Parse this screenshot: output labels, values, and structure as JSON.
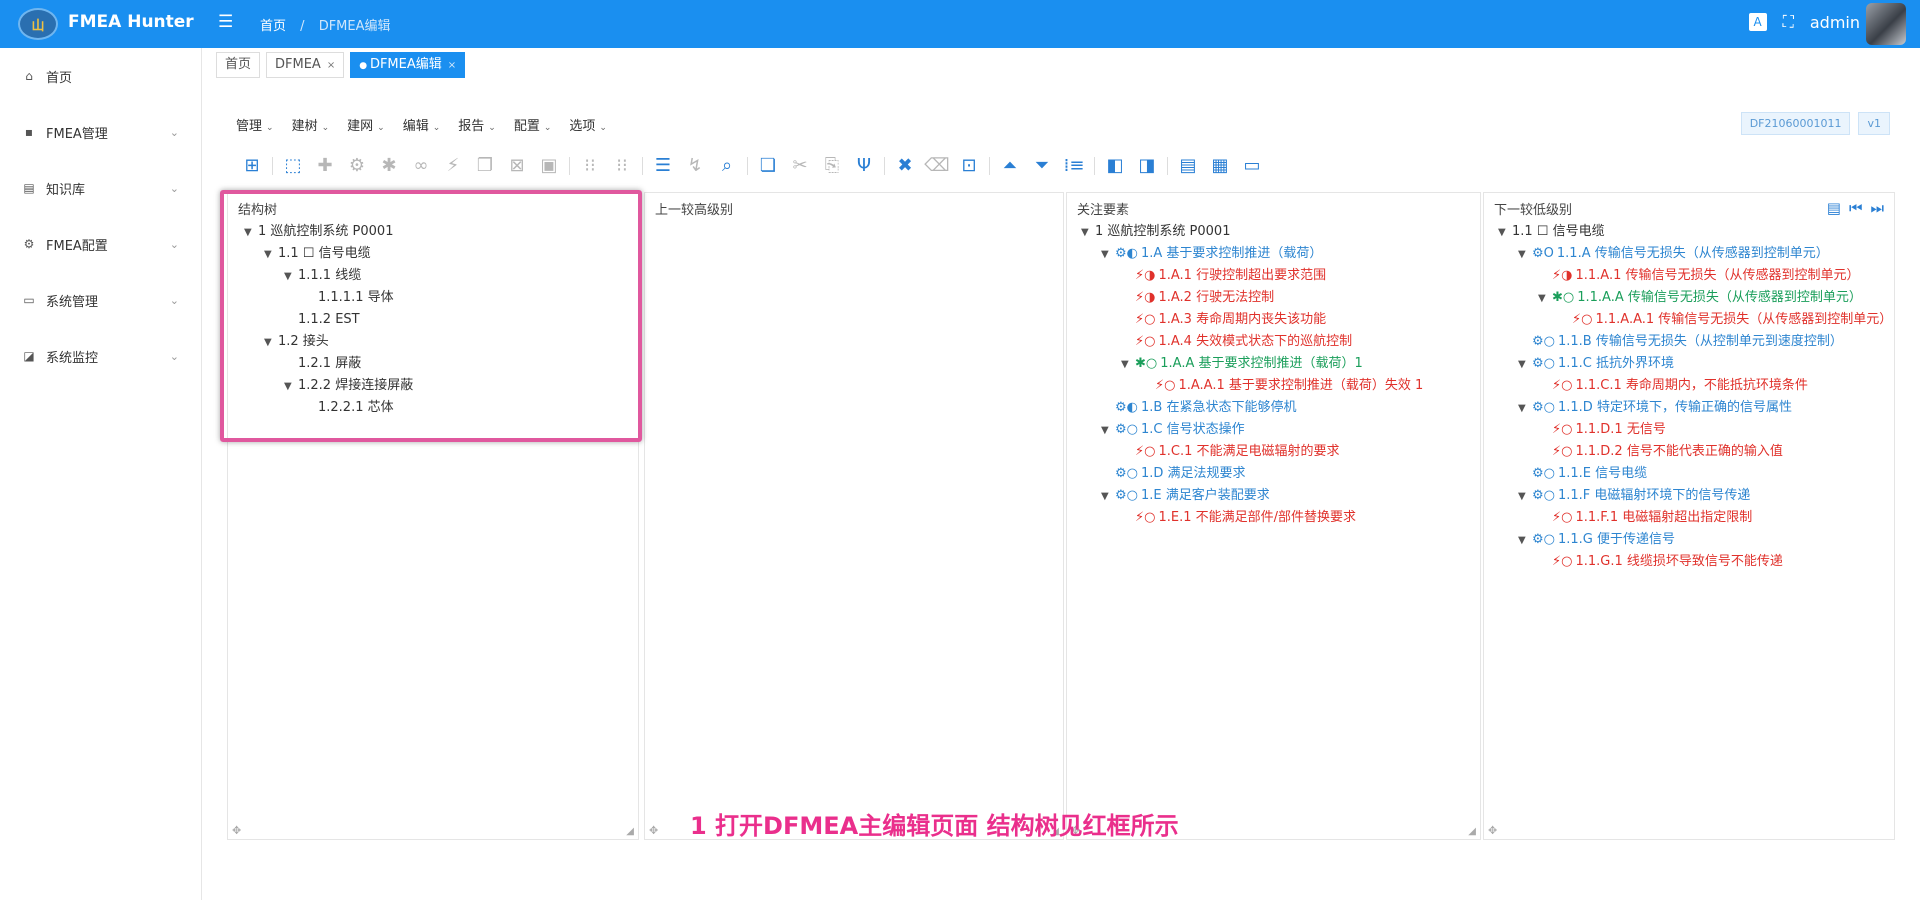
{
  "app": {
    "title": "FMEA Hunter",
    "logo_text": "山"
  },
  "header": {
    "breadcrumb": [
      "首页",
      "DFMEA编辑"
    ],
    "lang_label": "A",
    "user": "admin"
  },
  "sidebar": {
    "items": [
      {
        "label": "首页",
        "icon": "home-icon"
      },
      {
        "label": "FMEA管理",
        "icon": "fmea-icon"
      },
      {
        "label": "知识库",
        "icon": "book-icon"
      },
      {
        "label": "FMEA配置",
        "icon": "config-icon"
      },
      {
        "label": "系统管理",
        "icon": "monitor-icon"
      },
      {
        "label": "系统监控",
        "icon": "chart-icon"
      }
    ]
  },
  "tabs": [
    {
      "label": "首页",
      "closable": false,
      "active": false
    },
    {
      "label": "DFMEA",
      "closable": true,
      "active": false
    },
    {
      "label": "DFMEA编辑",
      "closable": true,
      "active": true
    }
  ],
  "menubar": [
    "管理",
    "建树",
    "建网",
    "编辑",
    "报告",
    "配置",
    "选项"
  ],
  "doc": {
    "id": "DF21060001011",
    "version": "v1"
  },
  "panels": {
    "structure": {
      "title": "结构树",
      "nodes": [
        {
          "text": "1 巡航控制系统 P0001",
          "level": 0,
          "toggle": "▼",
          "cls": "dark",
          "ico": ""
        },
        {
          "text": "1.1 ☐ 信号电缆",
          "level": 1,
          "toggle": "▼",
          "cls": "dark",
          "ico": ""
        },
        {
          "text": "1.1.1 线缆",
          "level": 2,
          "toggle": "▼",
          "cls": "dark",
          "ico": ""
        },
        {
          "text": "1.1.1.1 导体",
          "level": 3,
          "toggle": "",
          "cls": "dark",
          "ico": ""
        },
        {
          "text": "1.1.2 EST",
          "level": 2,
          "toggle": "",
          "cls": "dark",
          "ico": ""
        },
        {
          "text": "1.2 接头",
          "level": 1,
          "toggle": "▼",
          "cls": "dark",
          "ico": ""
        },
        {
          "text": "1.2.1 屏蔽",
          "level": 2,
          "toggle": "",
          "cls": "dark",
          "ico": ""
        },
        {
          "text": "1.2.2 焊接连接屏蔽",
          "level": 2,
          "toggle": "▼",
          "cls": "dark",
          "ico": ""
        },
        {
          "text": "1.2.2.1 芯体",
          "level": 3,
          "toggle": "",
          "cls": "dark",
          "ico": ""
        }
      ]
    },
    "upper": {
      "title": "上一较高级别"
    },
    "focus": {
      "title": "关注要素",
      "nodes": [
        {
          "text": "1 巡航控制系统 P0001",
          "level": 0,
          "toggle": "▼",
          "cls": "dark",
          "ico": ""
        },
        {
          "text": "1.A 基于要求控制推进（载荷）",
          "level": 1,
          "toggle": "▼",
          "cls": "blue",
          "ico": "⚙◐"
        },
        {
          "text": "1.A.1 行驶控制超出要求范围",
          "level": 2,
          "toggle": "",
          "cls": "red",
          "ico": "⚡◑"
        },
        {
          "text": "1.A.2 行驶无法控制",
          "level": 2,
          "toggle": "",
          "cls": "red",
          "ico": "⚡◑"
        },
        {
          "text": "1.A.3 寿命周期内丧失该功能",
          "level": 2,
          "toggle": "",
          "cls": "red",
          "ico": "⚡○"
        },
        {
          "text": "1.A.4 失效模式状态下的巡航控制",
          "level": 2,
          "toggle": "",
          "cls": "red",
          "ico": "⚡○"
        },
        {
          "text": "1.A.A 基于要求控制推进（载荷）1",
          "level": 2,
          "toggle": "▼",
          "cls": "green",
          "ico": "✱○"
        },
        {
          "text": "1.A.A.1 基于要求控制推进（载荷）失效 1",
          "level": 3,
          "toggle": "",
          "cls": "red",
          "ico": "⚡○"
        },
        {
          "text": "1.B 在紧急状态下能够停机",
          "level": 1,
          "toggle": "",
          "cls": "blue",
          "ico": "⚙◐"
        },
        {
          "text": "1.C 信号状态操作",
          "level": 1,
          "toggle": "▼",
          "cls": "blue",
          "ico": "⚙○"
        },
        {
          "text": "1.C.1 不能满足电磁辐射的要求",
          "level": 2,
          "toggle": "",
          "cls": "red",
          "ico": "⚡○"
        },
        {
          "text": "1.D 满足法规要求",
          "level": 1,
          "toggle": "",
          "cls": "blue",
          "ico": "⚙○"
        },
        {
          "text": "1.E 满足客户装配要求",
          "level": 1,
          "toggle": "▼",
          "cls": "blue",
          "ico": "⚙○"
        },
        {
          "text": "1.E.1 不能满足部件/部件替换要求",
          "level": 2,
          "toggle": "",
          "cls": "red",
          "ico": "⚡○"
        }
      ]
    },
    "lower": {
      "title": "下一较低级别",
      "nodes": [
        {
          "text": "1.1 ☐ 信号电缆",
          "level": 0,
          "toggle": "▼",
          "cls": "dark",
          "ico": ""
        },
        {
          "text": "1.1.A 传输信号无损失（从传感器到控制单元）",
          "level": 1,
          "toggle": "▼",
          "cls": "blue",
          "ico": "⚙O"
        },
        {
          "text": "1.1.A.1 传输信号无损失（从传感器到控制单元）",
          "level": 2,
          "toggle": "",
          "cls": "red",
          "ico": "⚡◑"
        },
        {
          "text": "1.1.A.A 传输信号无损失（从传感器到控制单元）",
          "level": 2,
          "toggle": "▼",
          "cls": "green",
          "ico": "✱○"
        },
        {
          "text": "1.1.A.A.1 传输信号无损失（从传感器到控制单元）",
          "level": 3,
          "toggle": "",
          "cls": "red",
          "ico": "⚡○"
        },
        {
          "text": "1.1.B 传输信号无损失（从控制单元到速度控制）",
          "level": 1,
          "toggle": "",
          "cls": "blue",
          "ico": "⚙○"
        },
        {
          "text": "1.1.C 抵抗外界环境",
          "level": 1,
          "toggle": "▼",
          "cls": "blue",
          "ico": "⚙○"
        },
        {
          "text": "1.1.C.1 寿命周期内，不能抵抗环境条件",
          "level": 2,
          "toggle": "",
          "cls": "red",
          "ico": "⚡○"
        },
        {
          "text": "1.1.D 特定环境下，传输正确的信号属性",
          "level": 1,
          "toggle": "▼",
          "cls": "blue",
          "ico": "⚙○"
        },
        {
          "text": "1.1.D.1 无信号",
          "level": 2,
          "toggle": "",
          "cls": "red",
          "ico": "⚡○"
        },
        {
          "text": "1.1.D.2 信号不能代表正确的输入值",
          "level": 2,
          "toggle": "",
          "cls": "red",
          "ico": "⚡○"
        },
        {
          "text": "1.1.E 信号电缆",
          "level": 1,
          "toggle": "",
          "cls": "blue",
          "ico": "⚙○"
        },
        {
          "text": "1.1.F 电磁辐射环境下的信号传递",
          "level": 1,
          "toggle": "▼",
          "cls": "blue",
          "ico": "⚙○"
        },
        {
          "text": "1.1.F.1 电磁辐射超出指定限制",
          "level": 2,
          "toggle": "",
          "cls": "red",
          "ico": "⚡○"
        },
        {
          "text": "1.1.G 便于传递信号",
          "level": 1,
          "toggle": "▼",
          "cls": "blue",
          "ico": "⚙○"
        },
        {
          "text": "1.1.G.1 线缆损坏导致信号不能传递",
          "level": 2,
          "toggle": "",
          "cls": "red",
          "ico": "⚡○"
        }
      ]
    }
  },
  "toolbar": [
    {
      "name": "add-node-icon",
      "glyph": "⊞",
      "on": true
    },
    {
      "sep": true
    },
    {
      "name": "structure-icon",
      "glyph": "⬚",
      "on": true
    },
    {
      "name": "puzzle-icon",
      "glyph": "✚",
      "on": false
    },
    {
      "name": "gear-icon",
      "glyph": "⚙",
      "on": false
    },
    {
      "name": "asterisk-icon",
      "glyph": "✱",
      "on": false
    },
    {
      "name": "link-icon",
      "glyph": "∞",
      "on": false
    },
    {
      "name": "bolt-icon",
      "glyph": "⚡",
      "on": false
    },
    {
      "name": "copy-icon",
      "glyph": "❐",
      "on": false
    },
    {
      "name": "delete-box-icon",
      "glyph": "⊠",
      "on": false
    },
    {
      "name": "paste-box-icon",
      "glyph": "▣",
      "on": false
    },
    {
      "sep": true
    },
    {
      "name": "grid-icon",
      "glyph": "⁝⁝",
      "on": false
    },
    {
      "name": "grid2-icon",
      "glyph": "⁝⁝",
      "on": false
    },
    {
      "sep": true
    },
    {
      "name": "list-icon",
      "glyph": "☰",
      "on": true
    },
    {
      "name": "pin-icon",
      "glyph": "↯",
      "on": false
    },
    {
      "name": "search-icon",
      "glyph": "⌕",
      "on": true
    },
    {
      "sep": true
    },
    {
      "name": "copy-doc-icon",
      "glyph": "❏",
      "on": true
    },
    {
      "name": "cut-icon",
      "glyph": "✂",
      "on": false
    },
    {
      "name": "paste-icon",
      "glyph": "⎘",
      "on": false
    },
    {
      "name": "fork-icon",
      "glyph": "Ψ",
      "on": true
    },
    {
      "sep": true
    },
    {
      "name": "close-x-icon",
      "glyph": "✖",
      "on": true
    },
    {
      "name": "backspace-icon",
      "glyph": "⌫",
      "on": false
    },
    {
      "name": "focus-icon",
      "glyph": "⊡",
      "on": true
    },
    {
      "sep": true
    },
    {
      "name": "collapse-up-icon",
      "glyph": "⏶",
      "on": true
    },
    {
      "name": "expand-down-icon",
      "glyph": "⏷",
      "on": true
    },
    {
      "name": "numbered-list-icon",
      "glyph": "⁞≡",
      "on": true
    },
    {
      "sep": true
    },
    {
      "name": "split-left-icon",
      "glyph": "◧",
      "on": true
    },
    {
      "name": "split-right-icon",
      "glyph": "◨",
      "on": true
    },
    {
      "sep": true
    },
    {
      "name": "table-icon",
      "glyph": "▤",
      "on": true
    },
    {
      "name": "table-grid-icon",
      "glyph": "▦",
      "on": true
    },
    {
      "name": "window-icon",
      "glyph": "▭",
      "on": true
    }
  ],
  "caption": "1 打开DFMEA主编辑页面  结构树见红框所示",
  "colors": {
    "brand": "#1a8ff0",
    "highlight": "#e0589e",
    "caption": "#ea2f8c"
  }
}
